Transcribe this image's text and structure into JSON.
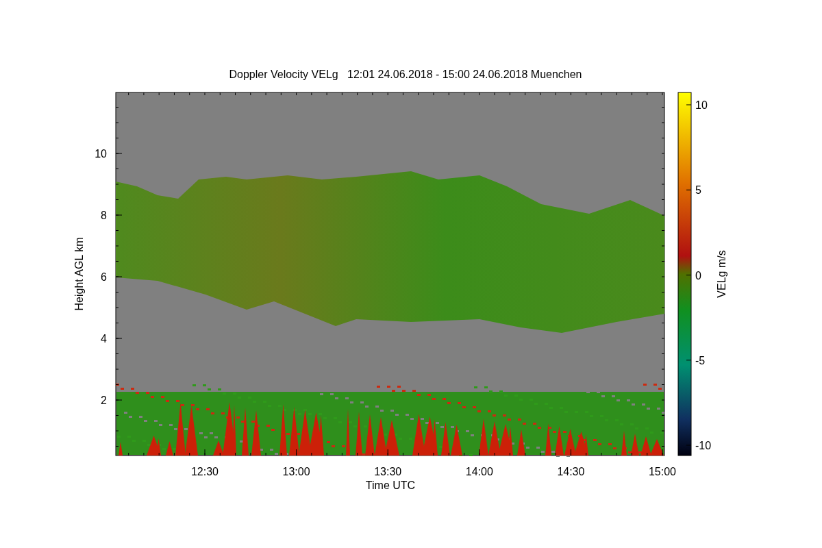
{
  "title": "Doppler Velocity VELg   12:01 24.06.2018 - 15:00 24.06.2018 Muenchen",
  "y_axis": {
    "label": "Height AGL km",
    "ticks": [
      "10",
      "8",
      "6",
      "4",
      "2"
    ]
  },
  "x_axis": {
    "label": "Time UTC",
    "ticks": [
      "12:30",
      "13:00",
      "13:30",
      "14:00",
      "14:30",
      "15:00"
    ]
  },
  "colorbar": {
    "label": "VELg m/s",
    "ticks": [
      "10",
      "5",
      "0",
      "-5",
      "-10"
    ]
  }
}
